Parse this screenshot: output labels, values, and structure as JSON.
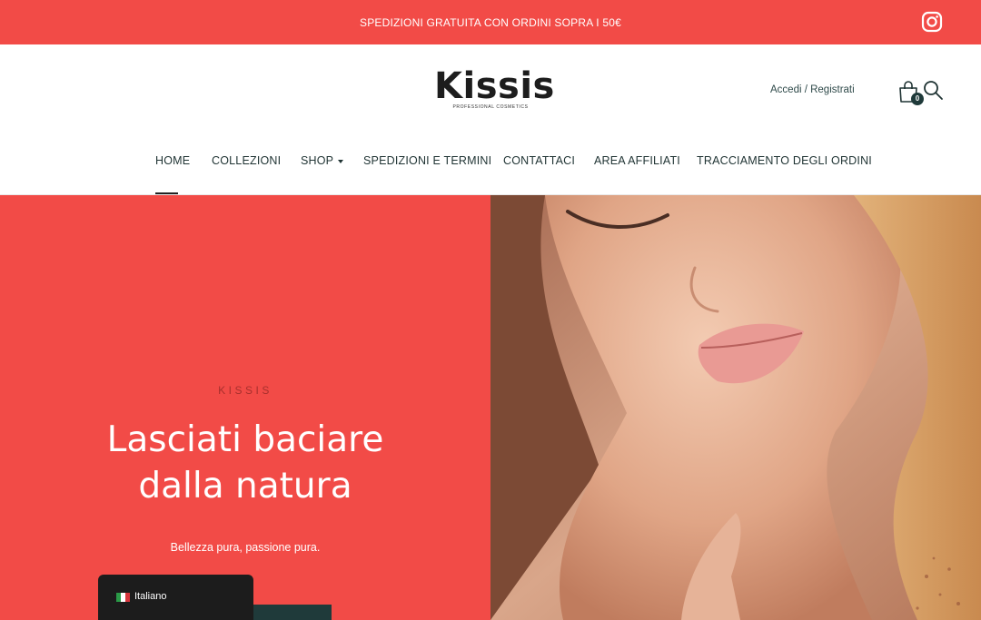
{
  "topbar": {
    "text": "SPEDIZIONI GRATUITA CON ORDINI SOPRA I 50€",
    "instagram_icon": "instagram-icon"
  },
  "header": {
    "logo_main": "Kissis",
    "logo_sub": "PROFESSIONAL COSMETICS",
    "account_link": "Accedi / Registrati",
    "cart_count": "0",
    "icons": [
      "cart-icon",
      "search-icon"
    ]
  },
  "nav": {
    "items": [
      {
        "label": "HOME"
      },
      {
        "label": "COLLEZIONI"
      },
      {
        "label": "SHOP"
      },
      {
        "label": "SPEDIZIONI E TERMINI"
      },
      {
        "label": "CONTATTACI"
      },
      {
        "label": "AREA AFFILIATI"
      },
      {
        "label": "TRACCIAMENTO DEGLI ORDINI"
      }
    ],
    "active": "HOME"
  },
  "hero": {
    "eyebrow": "KISSIS",
    "title_line1": "Lasciati baciare",
    "title_line2": "dalla natura",
    "subtitle": "Bellezza pura, passione pura."
  },
  "language": {
    "label": "Italiano",
    "flag_icon": "italy-flag-icon"
  },
  "colors": {
    "brand_red": "#f24b47",
    "dark_teal": "#1f3a3a"
  }
}
